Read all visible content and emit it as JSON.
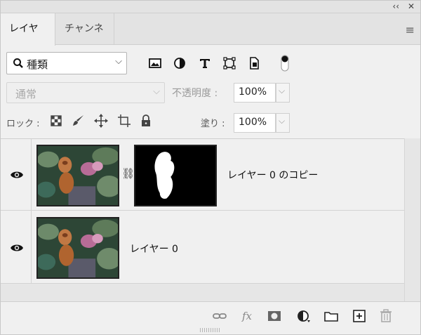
{
  "window": {
    "collapse_glyph": "‹‹",
    "close_glyph": "✕"
  },
  "tabs": [
    {
      "label": "レイヤー",
      "active": true
    },
    {
      "label": "チャンネル",
      "active": false
    }
  ],
  "panel_menu_icon": "hamburger-icon",
  "filter": {
    "selected": "種類",
    "icons": [
      "image-icon",
      "adjustment-icon",
      "type-icon",
      "shape-icon",
      "smart-object-icon",
      "filter-toggle-icon"
    ]
  },
  "blend_mode": {
    "selected": "通常"
  },
  "opacity": {
    "label": "不透明度 :",
    "value": "100%"
  },
  "lock": {
    "label": "ロック :",
    "icons": [
      "lock-transparent-icon",
      "lock-paint-icon",
      "lock-move-icon",
      "lock-artboard-icon",
      "lock-all-icon"
    ]
  },
  "fill": {
    "label": "塗り :",
    "value": "100%"
  },
  "layers": [
    {
      "name": "レイヤー 0 のコピー",
      "visible": true,
      "has_mask": true
    },
    {
      "name": "レイヤー 0",
      "visible": true,
      "has_mask": false
    }
  ],
  "bottom_toolbar": {
    "icons": [
      "link-icon",
      "fx-icon",
      "mask-icon",
      "adjustment-layer-icon",
      "group-folder-icon",
      "new-layer-icon",
      "trash-icon"
    ]
  },
  "colors": {
    "panel_bg": "#f0f0f0",
    "tab_bar_bg": "#e3e3e3",
    "mask_bg": "#000000"
  }
}
